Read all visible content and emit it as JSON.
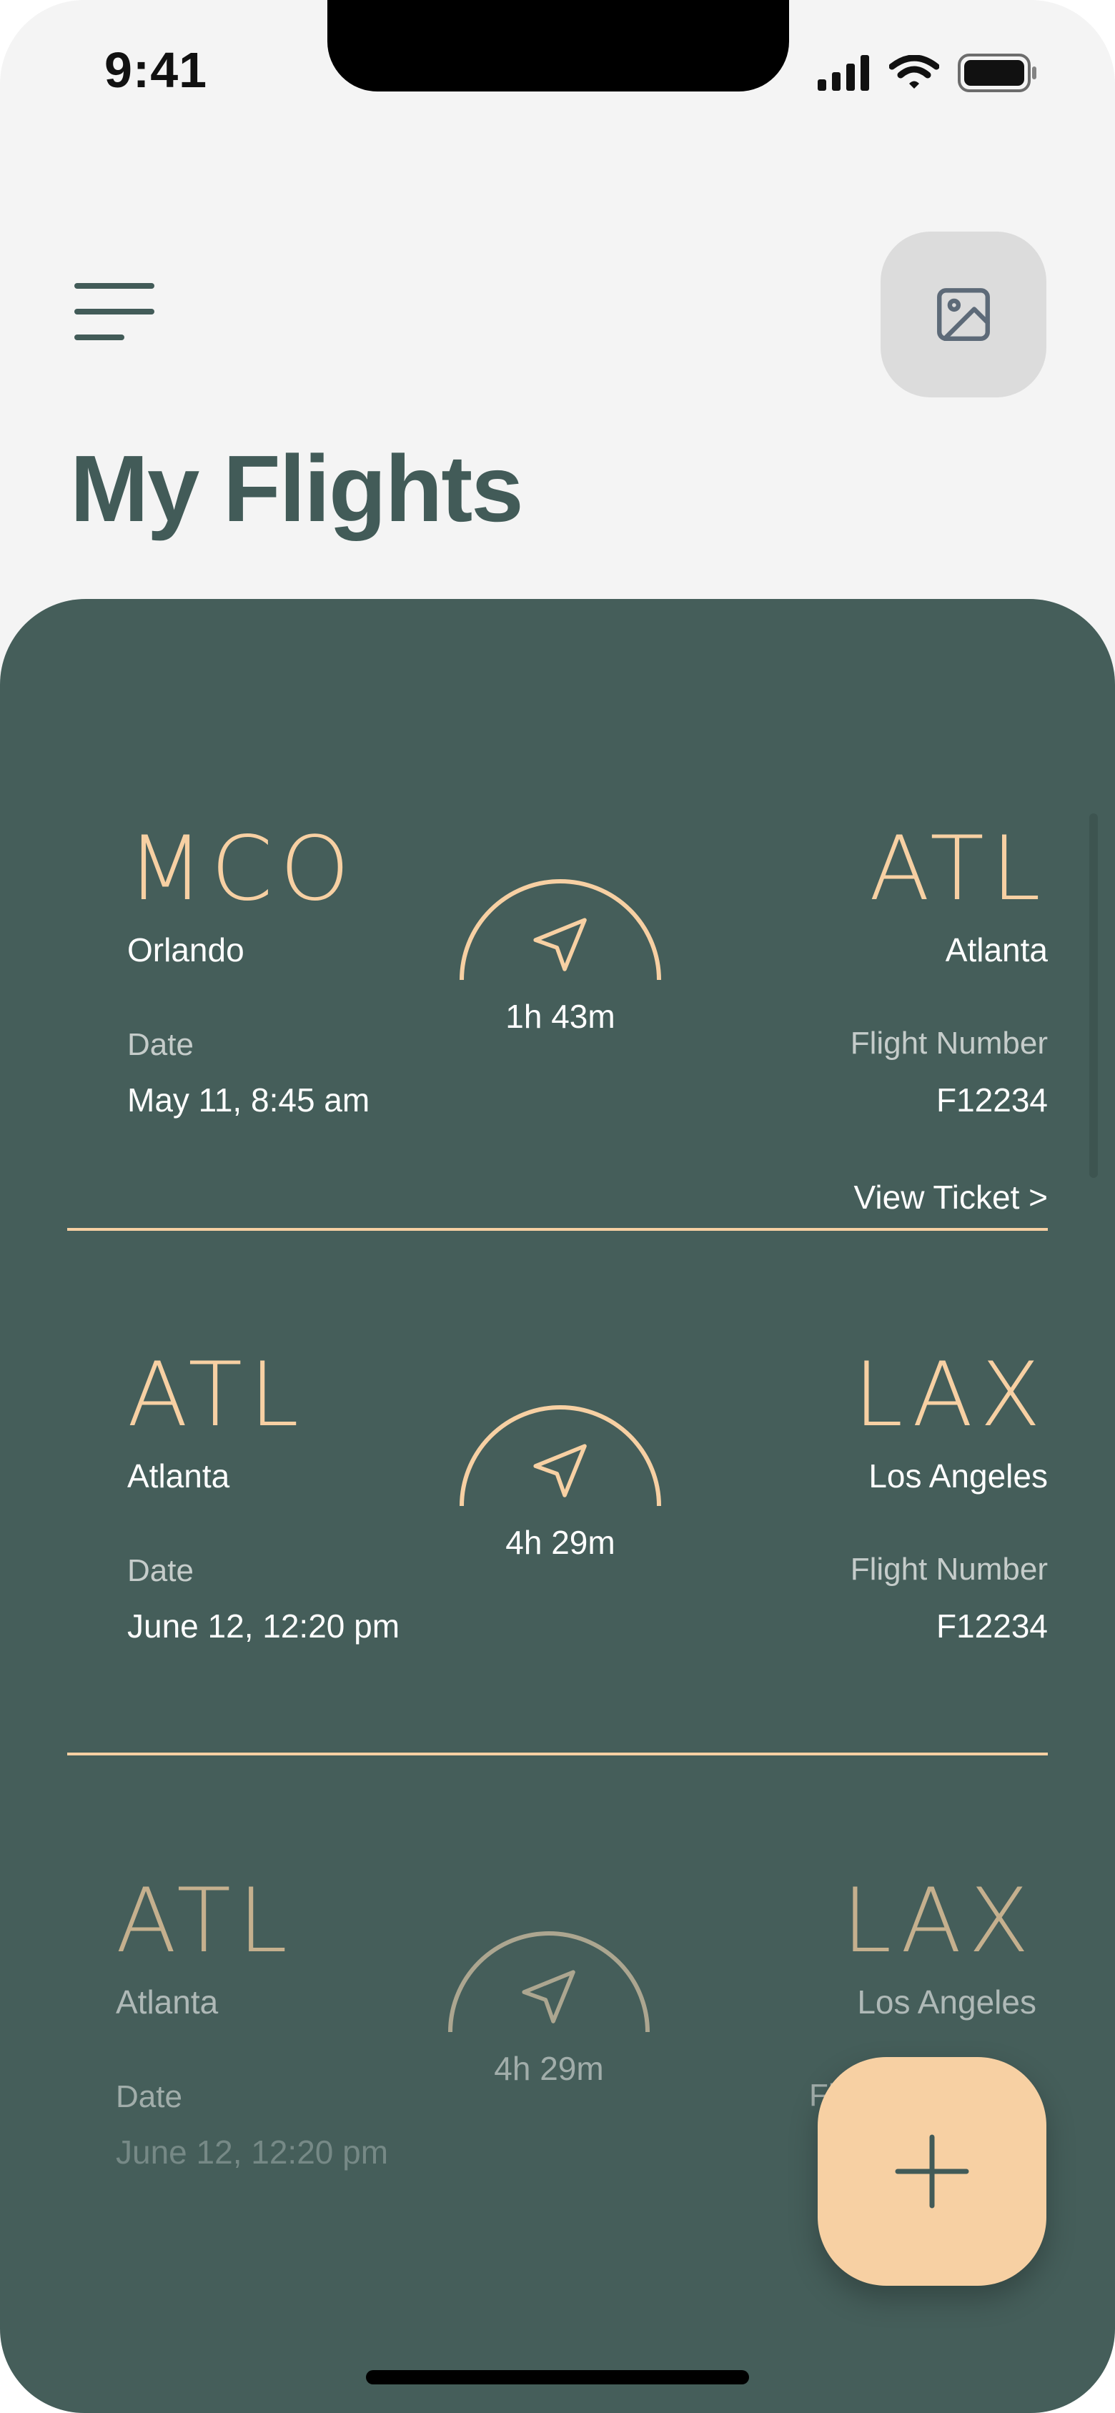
{
  "status_bar": {
    "time": "9:41"
  },
  "header": {
    "title": "My Flights"
  },
  "icons": {
    "menu": "hamburger-menu-icon",
    "photo": "image-icon",
    "plane": "navigation-arrow-icon",
    "add": "plus-icon"
  },
  "colors": {
    "accent": "#f7d0a3",
    "panel": "#455e5a",
    "title": "#425b58",
    "background": "#f4f4f4"
  },
  "flights": [
    {
      "from_code": "MCO",
      "from_city": "Orlando",
      "to_code": "ATL",
      "to_city": "Atlanta",
      "duration": "1h 43m",
      "date_label": "Date",
      "date": "May 11, 8:45 am",
      "flight_number_label": "Flight Number",
      "flight_number": "F12234",
      "view_ticket": "View Ticket >"
    },
    {
      "from_code": "ATL",
      "from_city": "Atlanta",
      "to_code": "LAX",
      "to_city": "Los Angeles",
      "duration": "4h 29m",
      "date_label": "Date",
      "date": "June 12, 12:20 pm",
      "flight_number_label": "Flight Number",
      "flight_number": "F12234"
    },
    {
      "from_code": "ATL",
      "from_city": "Atlanta",
      "to_code": "LAX",
      "to_city": "Los Angeles",
      "duration": "4h 29m",
      "date_label": "Date",
      "date": "June 12, 12:20 pm",
      "flight_number_label": "Flight"
    }
  ]
}
